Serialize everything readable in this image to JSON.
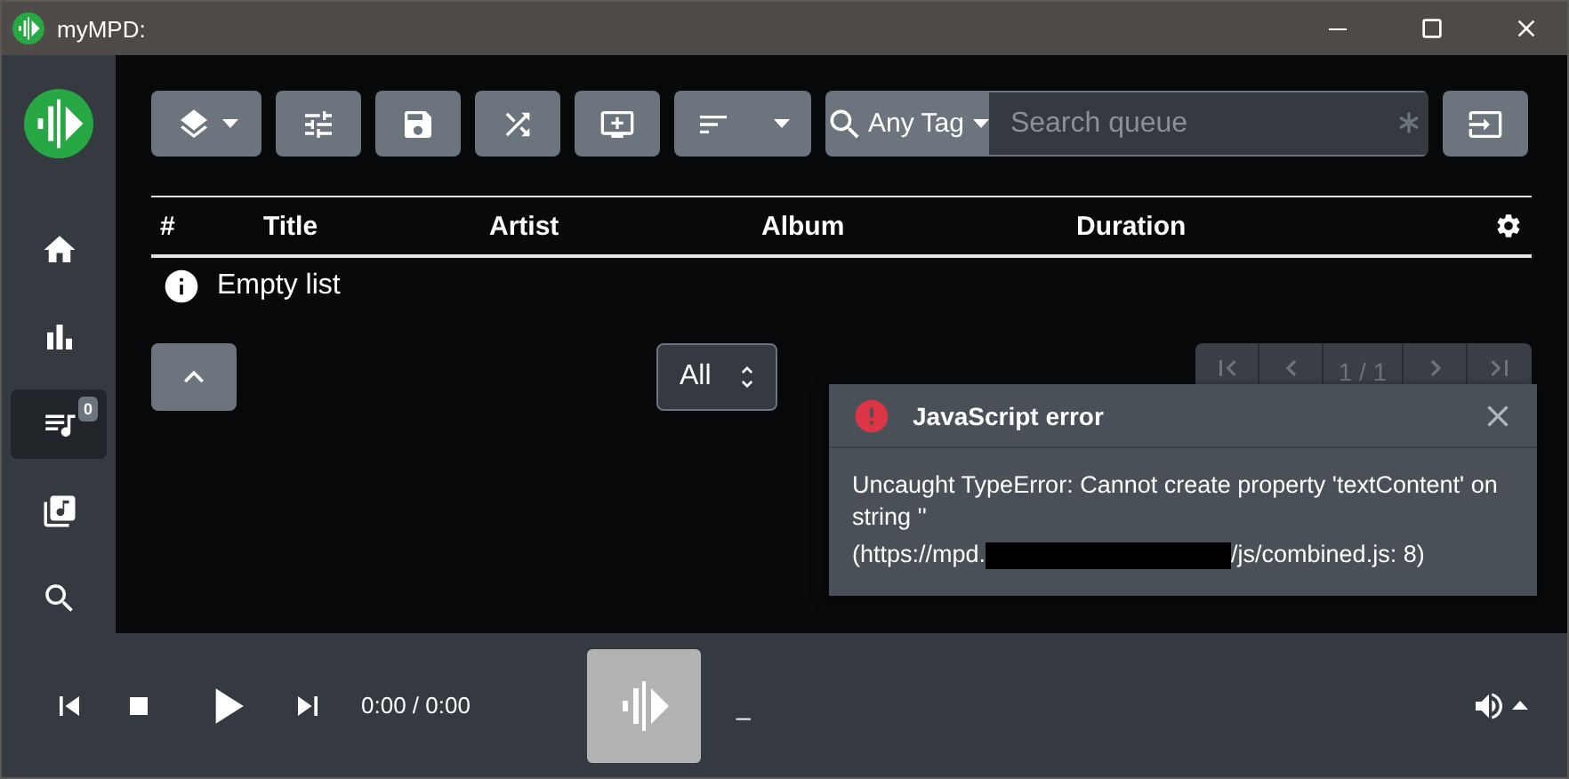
{
  "window": {
    "title": "myMPD:"
  },
  "sidebar": {
    "items": [
      {
        "kind": "home",
        "selected": false
      },
      {
        "kind": "stats",
        "selected": false
      },
      {
        "kind": "queue",
        "selected": true,
        "badge": "0"
      },
      {
        "kind": "library",
        "selected": false
      },
      {
        "kind": "search",
        "selected": false
      }
    ]
  },
  "toolbar": {
    "buttons": [
      {
        "kind": "layers",
        "dropdown": true
      },
      {
        "kind": "tune",
        "dropdown": false
      },
      {
        "kind": "save",
        "dropdown": false
      },
      {
        "kind": "shuffle",
        "dropdown": false
      },
      {
        "kind": "add-queue",
        "dropdown": false
      },
      {
        "kind": "sort",
        "dropdown": true
      }
    ]
  },
  "search": {
    "tag": "Any Tag",
    "placeholder": "Search queue"
  },
  "table": {
    "columns": [
      "#",
      "Title",
      "Artist",
      "Album",
      "Duration"
    ],
    "empty_message": "Empty list"
  },
  "filter": {
    "value": "All"
  },
  "pagination": {
    "page": "1 / 1"
  },
  "toast": {
    "title": "JavaScript error",
    "message": "Uncaught TypeError: Cannot create property 'textContent' on string ''",
    "source_prefix": "(https://mpd.",
    "source_suffix": "/js/combined.js: 8)"
  },
  "player": {
    "time": "0:00 / 0:00",
    "title": "_"
  }
}
